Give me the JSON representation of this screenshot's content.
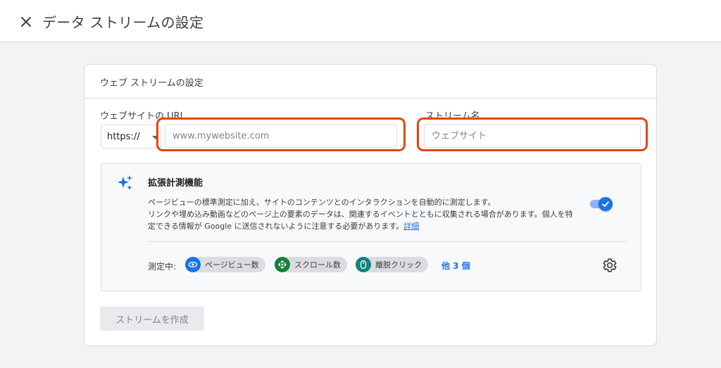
{
  "header": {
    "title": "データ ストリームの設定",
    "close_icon": "close-icon"
  },
  "card": {
    "title": "ウェブ ストリームの設定",
    "url_label": "ウェブサイトの URL",
    "protocol_value": "https://",
    "url_placeholder": "www.mywebsite.com",
    "stream_name_label": "ストリーム名",
    "stream_name_placeholder": "ウェブサイト"
  },
  "enhanced_measurement": {
    "title": "拡張計測機能",
    "description_line1": "ページビューの標準測定に加え、サイトのコンテンツとのインタラクションを自動的に測定します。",
    "description_line2": "リンクや埋め込み動画などのページ上の要素のデータは、関連するイベントとともに収集される場合があります。個人を特",
    "description_line3": "定できる情報が Google に送信されないように注意する必要があります。",
    "details_link": "詳細",
    "toggle_on": true,
    "measuring_label": "測定中:",
    "chips": [
      {
        "label": "ページビュー数",
        "icon": "eye-icon",
        "color": "#1a73e8"
      },
      {
        "label": "スクロール数",
        "icon": "scroll-icon",
        "color": "#188038"
      },
      {
        "label": "離脱クリック",
        "icon": "mouse-icon",
        "color": "#12837e"
      }
    ],
    "more_link": "他 3 個",
    "settings_icon": "gear-icon"
  },
  "actions": {
    "create_stream_label": "ストリームを作成"
  },
  "colors": {
    "highlight": "#e8430c",
    "accent": "#1a73e8"
  }
}
